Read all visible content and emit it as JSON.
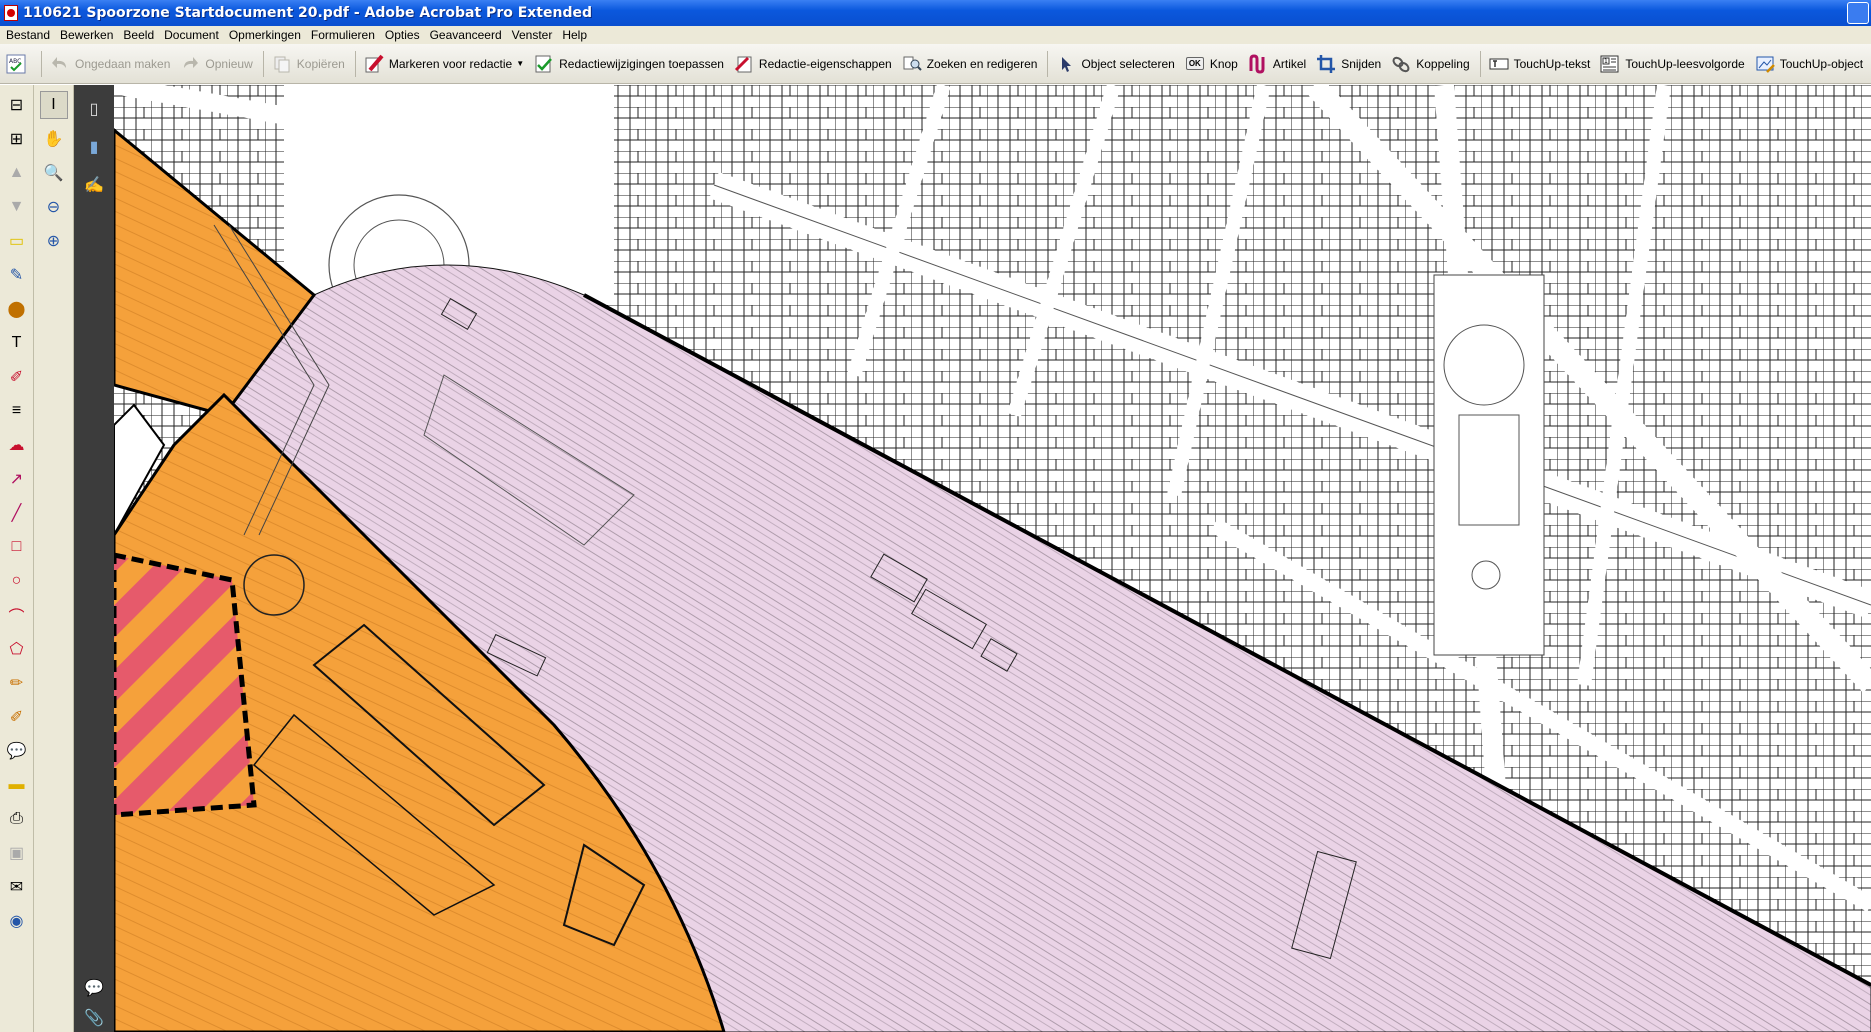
{
  "window": {
    "title": "110621 Spoorzone Startdocument 20.pdf - Adobe Acrobat Pro Extended"
  },
  "menubar": {
    "items": [
      "Bestand",
      "Bewerken",
      "Beeld",
      "Document",
      "Opmerkingen",
      "Formulieren",
      "Opties",
      "Geavanceerd",
      "Venster",
      "Help"
    ]
  },
  "toolbar": {
    "undo": "Ongedaan maken",
    "redo": "Opnieuw",
    "copy": "Kopiëren",
    "mark_redaction": "Markeren voor redactie",
    "apply_redactions": "Redactiewijzigingen toepassen",
    "redaction_properties": "Redactie-eigenschappen",
    "search_redact": "Zoeken en redigeren",
    "select_object": "Object selecteren",
    "button_tool": "Knop",
    "button_icon_text": "OK",
    "article": "Artikel",
    "crop": "Snijden",
    "link": "Koppeling",
    "touchup_text": "TouchUp-tekst",
    "touchup_reading_order": "TouchUp-leesvolgorde",
    "touchup_object": "TouchUp-object"
  },
  "icons": {
    "spell_check": "spell-check-icon",
    "undo": "undo-icon",
    "redo": "redo-icon",
    "copy": "copy-icon",
    "mark_redaction": "redaction-marker-icon",
    "apply_redactions": "apply-redaction-icon",
    "redaction_properties": "redaction-properties-icon",
    "search_redact": "search-redact-icon",
    "select_object": "cursor-arrow-icon",
    "article": "article-icon",
    "crop": "crop-icon",
    "link": "link-icon",
    "touchup_text": "touchup-text-icon",
    "touchup_reading_order": "reading-order-icon",
    "touchup_object": "touchup-object-icon"
  },
  "colors": {
    "zone_orange": "#f5a13b",
    "zone_pink": "#ead3e6",
    "hatch_red": "#e65a6b",
    "title_blue": "#0a55d6"
  }
}
